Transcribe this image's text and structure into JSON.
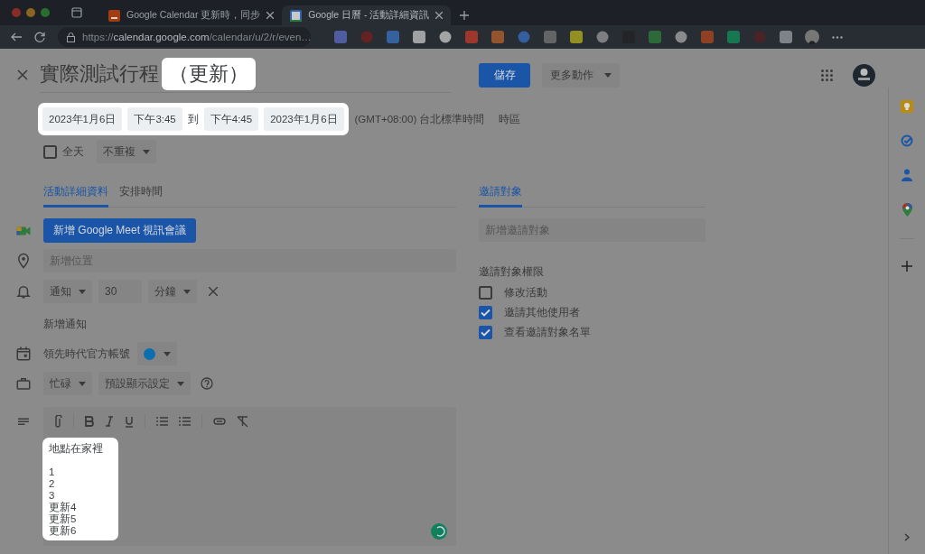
{
  "browser": {
    "tabs": [
      {
        "title": "Google Calendar 更新時，同步",
        "selected": false
      },
      {
        "title": "Google 日曆 - 活動詳細資訊",
        "selected": true
      }
    ],
    "url": "https://**calendar.google.com**/calendar/u/2/r/even…"
  },
  "event": {
    "title": "實際測試行程",
    "title_suffix": "（更新）",
    "start_date": "2023年1月6日",
    "start_time": "下午3:45",
    "to": "到",
    "end_time": "下午4:45",
    "end_date": "2023年1月6日",
    "timezone": "(GMT+08:00) 台北標準時間",
    "timezone_link": "時區",
    "all_day": {
      "label": "全天",
      "checked": false
    },
    "repeat": "不重複",
    "save": "儲存",
    "more_actions": "更多動作",
    "tabs": [
      {
        "label": "活動詳細資料",
        "selected": true
      },
      {
        "label": "安排時間",
        "selected": false
      }
    ],
    "meet_button": "新增 Google Meet 視訊會議",
    "location_placeholder": "新增位置",
    "notification": {
      "type": "通知",
      "value": "30",
      "unit": "分鐘"
    },
    "add_notification": "新增通知",
    "calendar": {
      "name": "領先時代官方帳號",
      "color": "#0a6fb0"
    },
    "availability": "忙碌",
    "visibility": "預設顯示設定",
    "description": {
      "paragraphs": [
        [
          "地點在家裡"
        ],
        [
          "1",
          "2",
          "3",
          "更新4",
          "更新5",
          "更新6"
        ]
      ]
    }
  },
  "guests": {
    "tab": {
      "label": "邀請對象",
      "selected": true
    },
    "placeholder": "新增邀請對象",
    "permissions_title": "邀請對象權限",
    "permissions": [
      {
        "label": "修改活動",
        "checked": false
      },
      {
        "label": "邀請其他使用者",
        "checked": true
      },
      {
        "label": "查看邀請對象名單",
        "checked": true
      }
    ]
  }
}
